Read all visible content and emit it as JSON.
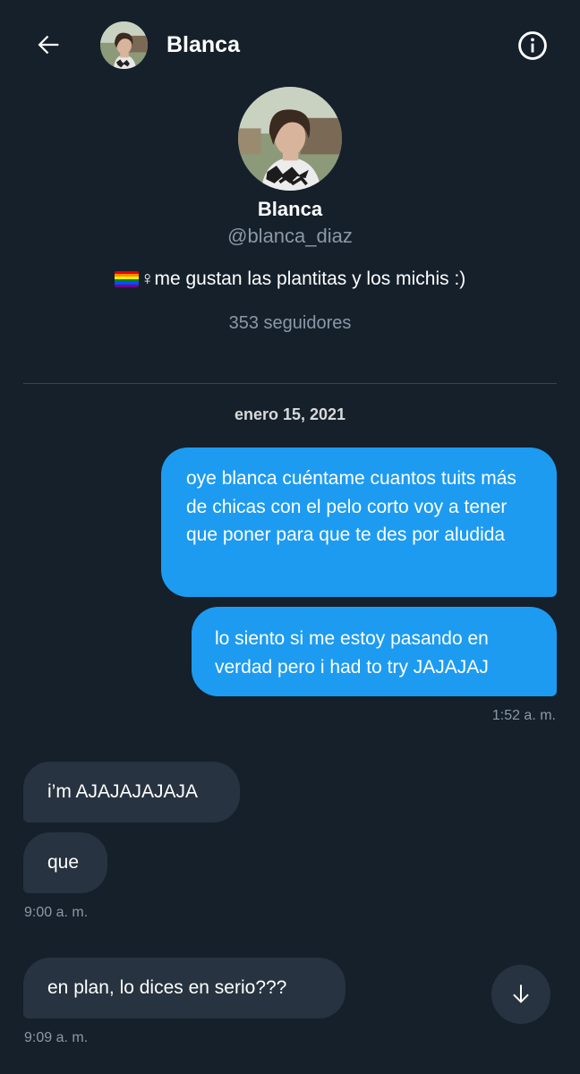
{
  "header": {
    "back_icon": "arrow-left-icon",
    "name": "Blanca",
    "info_icon": "info-circle-icon"
  },
  "profile": {
    "name": "Blanca",
    "handle": "@blanca_diaz",
    "bio_flag": "rainbow-flag-icon",
    "bio": "♀me gustan las plantitas y los michis :)",
    "followers": "353 seguidores"
  },
  "conversation": {
    "date": "enero 15, 2021",
    "messages": [
      {
        "direction": "sent",
        "text": "oye blanca cuéntame cuantos tuits más de chicas con el pelo corto voy a tener que poner para que te des por aludida"
      },
      {
        "direction": "sent",
        "text": "lo siento si me estoy pasando en verdad pero i had to try JAJAJAJ"
      },
      {
        "direction": "received",
        "text": "i’m AJAJAJAJAJA"
      },
      {
        "direction": "received",
        "text": "que"
      },
      {
        "direction": "received",
        "text": "en plan, lo dices en serio???"
      }
    ],
    "timestamps": [
      "1:52 a. m.",
      "9:00 a. m.",
      "9:09 a. m."
    ]
  },
  "scroll_button_icon": "arrow-down-icon",
  "colors": {
    "background": "#15202b",
    "sent_bubble": "#1d9bf0",
    "received_bubble": "#273340",
    "secondary_text": "#8b98a5",
    "divider": "#38444d"
  }
}
